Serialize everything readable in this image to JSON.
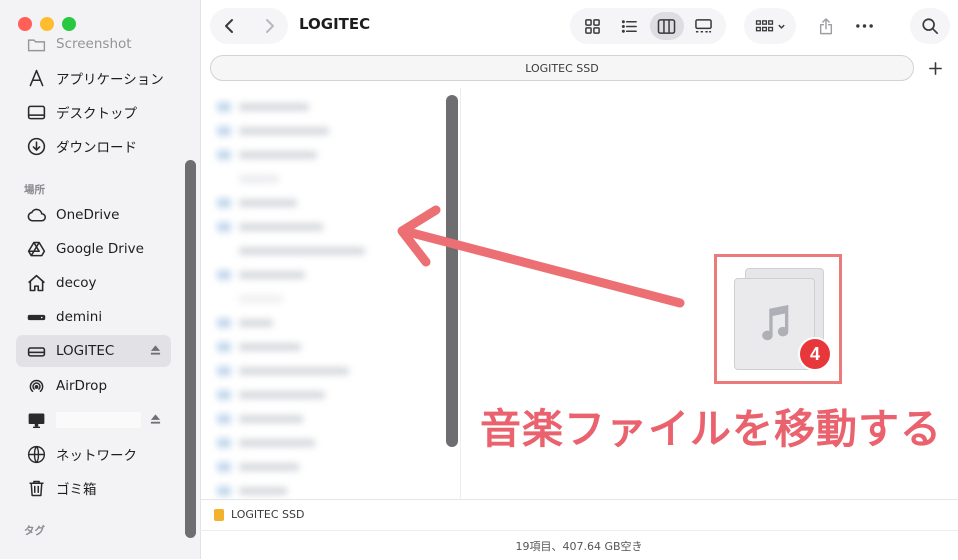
{
  "window": {
    "title": "LOGITEC",
    "tab_label": "LOGITEC SSD"
  },
  "sidebar": {
    "top_item": "Screenshot",
    "favorites": [
      {
        "label": "アプリケーション",
        "icon": "applications-icon"
      },
      {
        "label": "デスクトップ",
        "icon": "desktop-icon"
      },
      {
        "label": "ダウンロード",
        "icon": "downloads-icon"
      }
    ],
    "locations_header": "場所",
    "locations": [
      {
        "label": "OneDrive",
        "icon": "cloud-icon"
      },
      {
        "label": "Google Drive",
        "icon": "google-drive-icon"
      },
      {
        "label": "decoy",
        "icon": "home-icon"
      },
      {
        "label": "demini",
        "icon": "external-drive-icon"
      },
      {
        "label": "LOGITEC",
        "icon": "disk-icon"
      },
      {
        "label": "AirDrop",
        "icon": "airdrop-icon"
      },
      {
        "label": "",
        "icon": "computer-icon"
      },
      {
        "label": "ネットワーク",
        "icon": "network-icon"
      },
      {
        "label": "ゴミ箱",
        "icon": "trash-icon"
      }
    ],
    "tags_header": "タグ"
  },
  "pathbar": {
    "item": "LOGITEC SSD"
  },
  "status": {
    "text": "19項目、407.64 GB空き"
  },
  "annotation": {
    "caption": "音楽ファイルを移動する",
    "badge_count": "4",
    "color": "#e9626d"
  }
}
